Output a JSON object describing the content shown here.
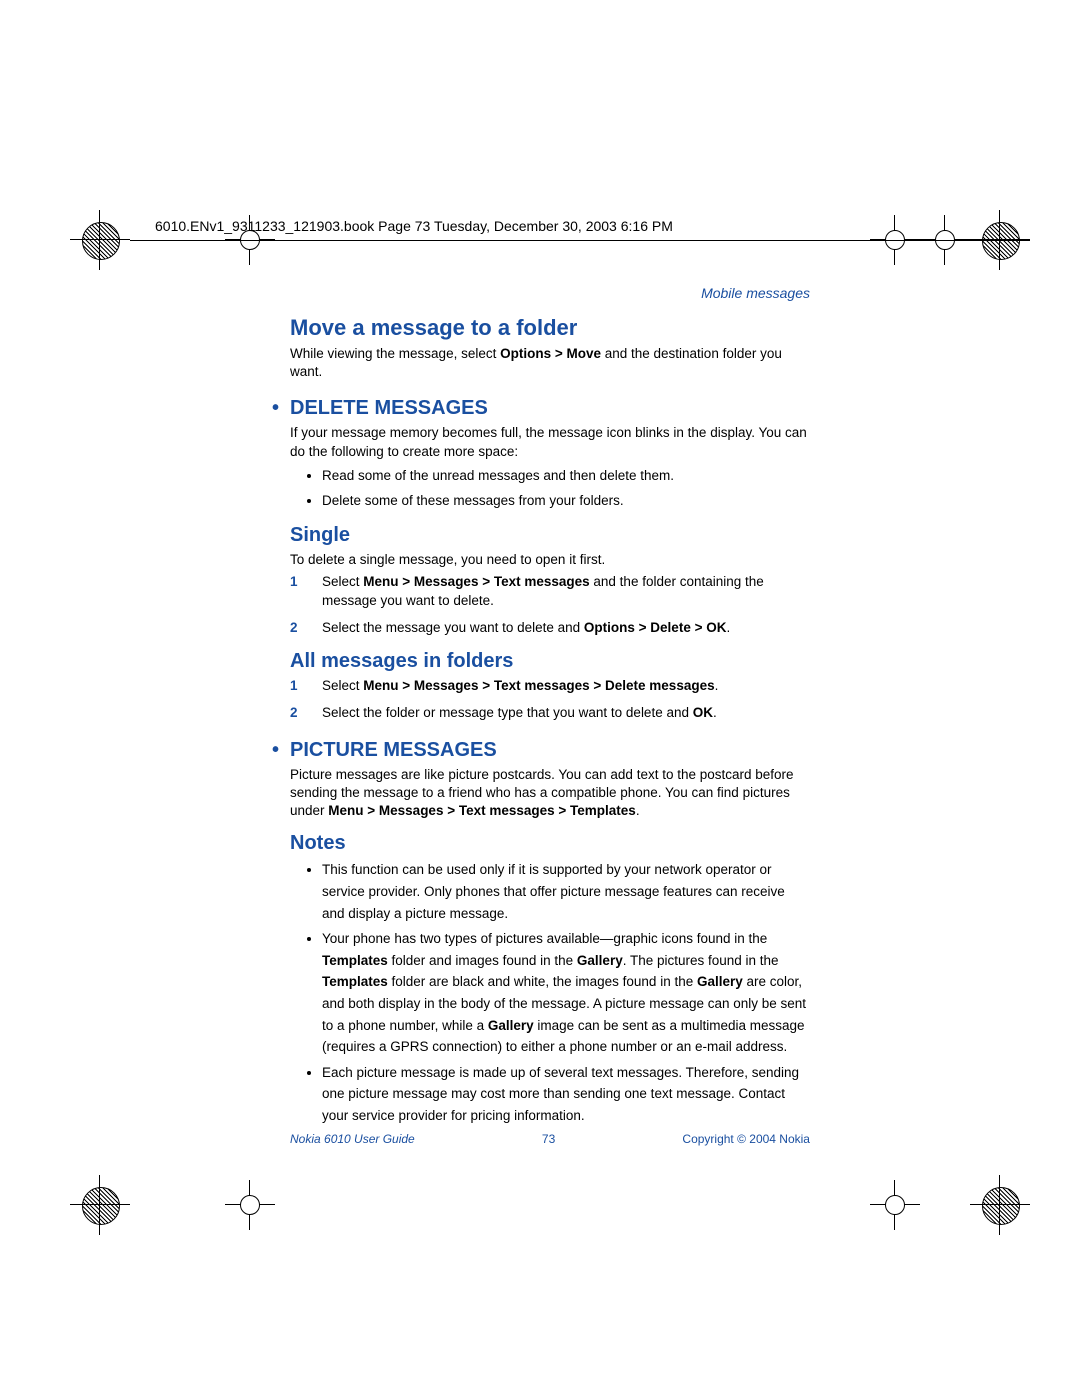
{
  "header": {
    "line": "6010.ENv1_9311233_121903.book  Page 73  Tuesday, December 30, 2003  6:16 PM"
  },
  "chapter": "Mobile messages",
  "sections": {
    "move": {
      "title": "Move a message to a folder",
      "para_pre": "While viewing the message, select ",
      "para_bold": "Options > Move",
      "para_post": " and the destination folder you want."
    },
    "deleteMessages": {
      "title": "• DELETE MESSAGES",
      "intro": "If your message memory becomes full, the message icon blinks in the display. You can do the following to create more space:",
      "bullets": [
        "Read some of the unread messages and then delete them.",
        "Delete some of these messages from your folders."
      ]
    },
    "single": {
      "title": "Single",
      "intro": "To delete a single message, you need to open it first.",
      "step1_pre": "Select ",
      "step1_bold": "Menu > Messages > Text messages",
      "step1_post": " and the folder containing the message you want to delete.",
      "step2_pre": "Select the message you want to delete and ",
      "step2_bold": "Options > Delete > OK",
      "step2_post": "."
    },
    "allFolders": {
      "title": "All messages in folders",
      "step1_pre": "Select ",
      "step1_bold": "Menu > Messages > Text messages > Delete messages",
      "step1_post": ".",
      "step2_pre": "Select the folder or message type that you want to delete and ",
      "step2_bold": "OK",
      "step2_post": "."
    },
    "picture": {
      "title": "• PICTURE MESSAGES",
      "para_pre": "Picture messages are like picture postcards. You can add text to the postcard before sending the message to a friend who has a compatible phone. You can find pictures under ",
      "para_bold": "Menu > Messages > Text messages > Templates",
      "para_post": "."
    },
    "notes": {
      "title": "Notes",
      "b1": "This function can be used only if it is supported by your network operator or service provider. Only phones that offer picture message features can receive and display a picture message.",
      "b2_a": "Your phone has two types of pictures available—graphic icons found in the ",
      "b2_bold1": "Templates",
      "b2_b": " folder and images found in the ",
      "b2_bold2": "Gallery",
      "b2_c": ". The pictures found in the ",
      "b2_bold3": "Templates",
      "b2_d": " folder are black and white, the images found in the ",
      "b2_bold4": "Gallery",
      "b2_e": " are color, and both display in the body of the message. A picture message can only be sent to a phone number, while a ",
      "b2_bold5": "Gallery",
      "b2_f": " image can be sent as a multimedia message (requires a GPRS connection) to either a phone number or an e-mail address.",
      "b3": "Each picture message is made up of several text messages. Therefore, sending one picture message may cost more than sending one text message. Contact your service provider for pricing information."
    }
  },
  "footer": {
    "left": "Nokia 6010 User Guide",
    "center": "73",
    "right": "Copyright © 2004 Nokia"
  }
}
